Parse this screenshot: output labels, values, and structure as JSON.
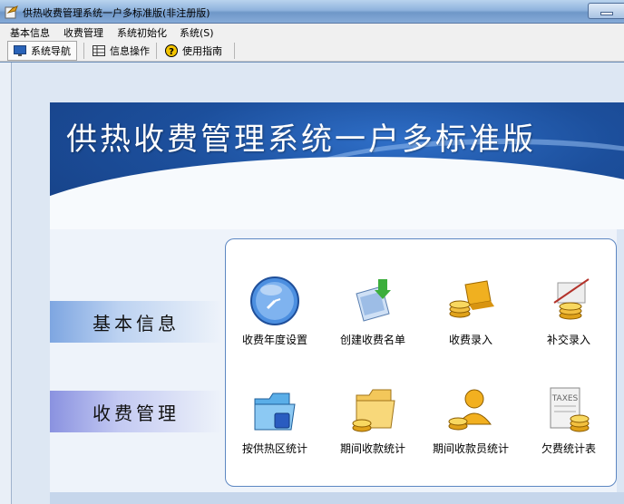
{
  "window": {
    "title": "供热收费管理系统一户多标准版(非注册版)"
  },
  "menu": {
    "items": [
      {
        "label": "基本信息"
      },
      {
        "label": "收费管理"
      },
      {
        "label": "系统初始化"
      },
      {
        "label": "系统(S)"
      }
    ]
  },
  "toolbar": {
    "items": [
      {
        "label": "系统导航",
        "icon": "monitor-icon"
      },
      {
        "label": "信息操作",
        "icon": "grid-icon"
      },
      {
        "label": "使用指南",
        "icon": "help-icon"
      }
    ]
  },
  "banner": {
    "title": "供热收费管理系统一户多标准版"
  },
  "nav": {
    "basic": "基本信息",
    "fee": "收费管理"
  },
  "functions": {
    "row1": [
      {
        "label": "收费年度设置",
        "icon": "clock-icon"
      },
      {
        "label": "创建收费名单",
        "icon": "document-download-icon"
      },
      {
        "label": "收费录入",
        "icon": "coins-laptop-icon"
      },
      {
        "label": "补交录入",
        "icon": "coins-scroll-icon"
      }
    ],
    "row2": [
      {
        "label": "按供热区统计",
        "icon": "folder-icon"
      },
      {
        "label": "期间收款统计",
        "icon": "folder-coins-icon"
      },
      {
        "label": "期间收款员统计",
        "icon": "user-coins-icon"
      },
      {
        "label": "欠费统计表",
        "icon": "taxes-icon"
      }
    ]
  },
  "colors": {
    "banner": "#1c4f9c",
    "accent": "#5d87c2"
  }
}
